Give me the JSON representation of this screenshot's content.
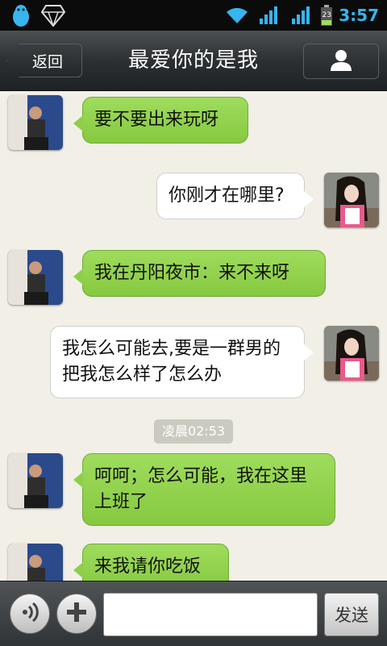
{
  "status_bar": {
    "time": "3:57",
    "battery_level": "23",
    "left_icons": [
      "qq-penguin-icon",
      "diamond-icon"
    ],
    "right_icons": [
      "wifi-icon",
      "signal-icon",
      "signal-icon",
      "battery-icon"
    ],
    "accent_color": "#35b6f0"
  },
  "title_bar": {
    "back_label": "返回",
    "title": "最爱你的是我",
    "profile_icon": "person-icon"
  },
  "messages": [
    {
      "side": "left",
      "text": "要不要出来玩呀",
      "bubble_color": "#93d450"
    },
    {
      "side": "right",
      "text": "你刚才在哪里?",
      "bubble_color": "#ffffff"
    },
    {
      "side": "left",
      "text": "我在丹阳夜市：来不来呀",
      "bubble_color": "#93d450"
    },
    {
      "side": "right",
      "text": "我怎么可能去,要是一群男的把我怎么样了怎么办",
      "bubble_color": "#ffffff"
    },
    {
      "side": "left",
      "text": "呵呵；怎么可能，我在这里上班了",
      "bubble_color": "#93d450"
    },
    {
      "side": "left",
      "text": "来我请你吃饭",
      "bubble_color": "#93d450"
    }
  ],
  "timestamp": "凌晨02:53",
  "bottom_bar": {
    "voice_icon": "voice-icon",
    "plus_icon": "plus-icon",
    "input_value": "",
    "send_label": "发送"
  }
}
